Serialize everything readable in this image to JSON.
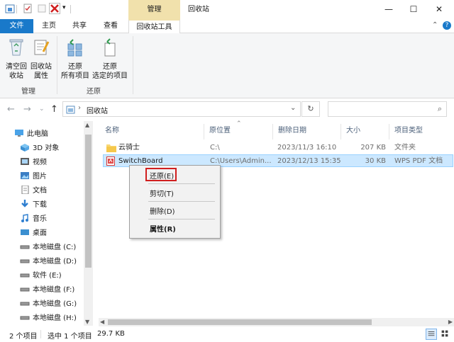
{
  "window": {
    "title": "回收站",
    "context_tab_header": "管理",
    "controls": {
      "minimize": "—",
      "maximize": "☐",
      "close": "✕"
    }
  },
  "tabs": [
    {
      "label": "文件",
      "active": false
    },
    {
      "label": "主页",
      "active": false
    },
    {
      "label": "共享",
      "active": false
    },
    {
      "label": "查看",
      "active": false
    },
    {
      "label": "回收站工具",
      "active": true
    }
  ],
  "ribbon": {
    "groups": [
      {
        "label": "管理",
        "buttons": [
          {
            "line1": "清空回",
            "line2": "收站",
            "icon": "recycle-bin-icon"
          },
          {
            "line1": "回收站",
            "line2": "属性",
            "icon": "properties-icon"
          }
        ]
      },
      {
        "label": "还原",
        "buttons": [
          {
            "line1": "还原",
            "line2": "所有项目",
            "icon": "restore-all-icon"
          },
          {
            "line1": "还原",
            "line2": "选定的项目",
            "icon": "restore-selected-icon"
          }
        ]
      }
    ]
  },
  "address": {
    "path": "回收站",
    "separator": "›"
  },
  "nav": {
    "items": [
      {
        "label": "此电脑",
        "icon": "computer-icon"
      },
      {
        "label": "3D 对象",
        "icon": "3d-objects-icon"
      },
      {
        "label": "视频",
        "icon": "video-icon"
      },
      {
        "label": "图片",
        "icon": "pictures-icon"
      },
      {
        "label": "文档",
        "icon": "documents-icon"
      },
      {
        "label": "下载",
        "icon": "download-icon"
      },
      {
        "label": "音乐",
        "icon": "music-icon"
      },
      {
        "label": "桌面",
        "icon": "desktop-icon"
      },
      {
        "label": "本地磁盘 (C:)",
        "icon": "drive-icon"
      },
      {
        "label": "本地磁盘 (D:)",
        "icon": "drive-icon"
      },
      {
        "label": "软件 (E:)",
        "icon": "drive-icon"
      },
      {
        "label": "本地磁盘 (F:)",
        "icon": "drive-icon"
      },
      {
        "label": "本地磁盘 (G:)",
        "icon": "drive-icon"
      },
      {
        "label": "本地磁盘 (H:)",
        "icon": "drive-icon"
      }
    ]
  },
  "columns": [
    "名称",
    "原位置",
    "删除日期",
    "大小",
    "项目类型"
  ],
  "rows": [
    {
      "name": "云骑士",
      "location": "C:\\",
      "date": "2023/11/3 16:10",
      "size": "207 KB",
      "type": "文件夹",
      "icon": "folder-icon",
      "selected": false
    },
    {
      "name": "SwitchBoard",
      "location": "C:\\Users\\Admin...",
      "date": "2023/12/13 15:35",
      "size": "30 KB",
      "type": "WPS PDF 文档",
      "icon": "pdf-icon",
      "selected": true
    }
  ],
  "context_menu": [
    {
      "label": "还原(E)",
      "highlighted": true
    },
    {
      "label": "剪切(T)"
    },
    {
      "label": "删除(D)"
    },
    {
      "label": "属性(R)",
      "bold": true
    }
  ],
  "status": {
    "item_count": "2 个项目",
    "selection": "选中 1 个项目",
    "size": "29.7 KB"
  },
  "colors": {
    "accent": "#1979ca",
    "context_tab": "#f1e1ac",
    "selection": "#cce8ff",
    "highlight_box": "#d01f1f"
  }
}
